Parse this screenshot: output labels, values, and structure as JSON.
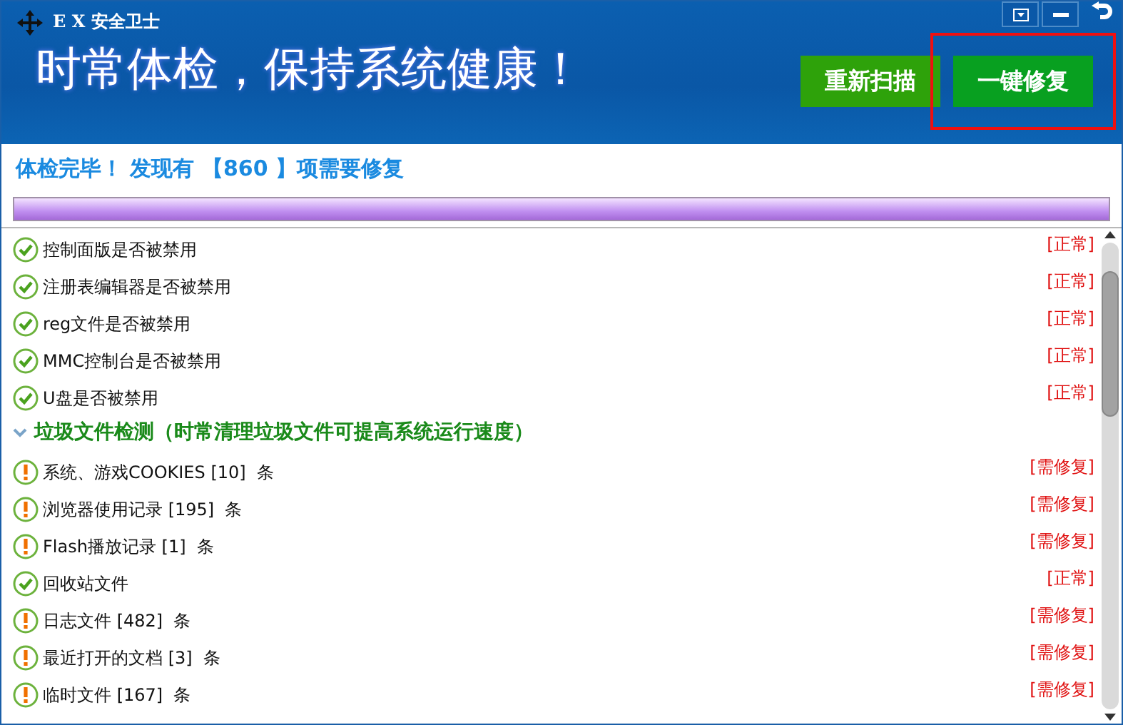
{
  "window": {
    "title": "E X 安全卫士"
  },
  "banner": {
    "headline": "时常体检，保持系统健康！"
  },
  "buttons": [
    {
      "label": "重新扫描",
      "highlighted": false
    },
    {
      "label": "一键修复",
      "highlighted": true
    }
  ],
  "summary": "体检完毕！ 发现有 【860 】项需要修复",
  "progress": {
    "level": 1
  },
  "rows": [
    {
      "kind": "item",
      "ok": true,
      "label": "控制面版是否被禁用",
      "status": "[正常]"
    },
    {
      "kind": "item",
      "ok": true,
      "label": "注册表编辑器是否被禁用",
      "status": "[正常]"
    },
    {
      "kind": "item",
      "ok": true,
      "label": "reg文件是否被禁用",
      "status": "[正常]"
    },
    {
      "kind": "item",
      "ok": true,
      "label": "MMC控制台是否被禁用",
      "status": "[正常]"
    },
    {
      "kind": "item",
      "ok": true,
      "label": "U盘是否被禁用",
      "status": "[正常]"
    },
    {
      "kind": "section",
      "expanded": true,
      "label": "垃圾文件检测（时常清理垃圾文件可提高系统运行速度）"
    },
    {
      "kind": "item",
      "ok": false,
      "label": "系统、游戏COOKIES [10]  条",
      "status": "[需修复]"
    },
    {
      "kind": "item",
      "ok": false,
      "label": "浏览器使用记录 [195]  条",
      "status": "[需修复]"
    },
    {
      "kind": "item",
      "ok": false,
      "label": "Flash播放记录 [1]  条",
      "status": "[需修复]"
    },
    {
      "kind": "item",
      "ok": true,
      "label": "回收站文件",
      "status": "[正常]"
    },
    {
      "kind": "item",
      "ok": false,
      "label": "日志文件 [482]  条",
      "status": "[需修复]"
    },
    {
      "kind": "item",
      "ok": false,
      "label": "最近打开的文档 [3]  条",
      "status": "[需修复]"
    },
    {
      "kind": "item",
      "ok": false,
      "label": "临时文件 [167]  条",
      "status": "[需修复]"
    }
  ]
}
